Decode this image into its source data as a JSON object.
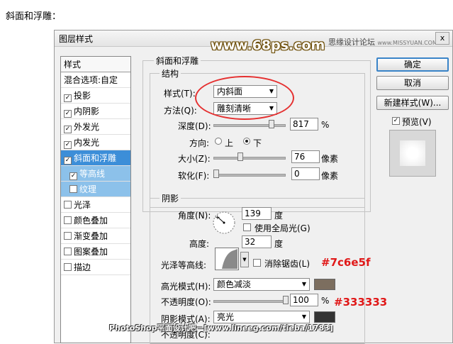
{
  "heading": "斜面和浮雕：",
  "dialog": {
    "title": "图层样式",
    "close": "x",
    "logo": "www.68ps.com",
    "watermark_cn": "思缘设计论坛",
    "watermark_en": "www.MISSYUAN.COM"
  },
  "style_list": {
    "header": "样式",
    "items": [
      {
        "label": "混合选项:自定",
        "checked": null
      },
      {
        "label": "投影",
        "checked": "✓"
      },
      {
        "label": "内阴影",
        "checked": "✓"
      },
      {
        "label": "外发光",
        "checked": "✓"
      },
      {
        "label": "内发光",
        "checked": "✓"
      },
      {
        "label": "斜面和浮雕",
        "checked": "✓"
      },
      {
        "label": "等高线",
        "checked": "✓"
      },
      {
        "label": "纹理",
        "checked": ""
      },
      {
        "label": "光泽",
        "checked": ""
      },
      {
        "label": "颜色叠加",
        "checked": ""
      },
      {
        "label": "渐变叠加",
        "checked": ""
      },
      {
        "label": "图案叠加",
        "checked": ""
      },
      {
        "label": "描边",
        "checked": ""
      }
    ]
  },
  "bevel": {
    "group": "斜面和浮雕",
    "structure": "结构",
    "style_label": "样式(T):",
    "style_value": "内斜面",
    "method_label": "方法(Q):",
    "method_value": "雕刻清晰",
    "depth_label": "深度(D):",
    "depth_value": "817",
    "depth_unit": "%",
    "direction_label": "方向:",
    "dir_up": "上",
    "dir_down": "下",
    "size_label": "大小(Z):",
    "size_value": "76",
    "size_unit": "像素",
    "soften_label": "软化(F):",
    "soften_value": "0",
    "soften_unit": "像素"
  },
  "shading": {
    "group": "阴影",
    "angle_label": "角度(N):",
    "angle_value": "139",
    "angle_unit": "度",
    "global_light": "使用全局光(G)",
    "altitude_label": "高度:",
    "altitude_value": "32",
    "altitude_unit": "度",
    "gloss_label": "光泽等高线:",
    "antialias": "消除锯齿(L)",
    "highlight_label": "高光模式(H):",
    "highlight_value": "颜色减淡",
    "highlight_color": "#7c6e5f",
    "opacity1_label": "不透明度(O):",
    "opacity1_value": "100",
    "opacity1_unit": "%",
    "shadow_label": "阴影模式(A):",
    "shadow_value": "亮光",
    "shadow_color": "#333333",
    "opacity2_label": "不透明度(C):"
  },
  "buttons": {
    "ok": "确定",
    "cancel": "取消",
    "new_style": "新建样式(W)...",
    "preview": "预览(V)"
  },
  "annotations": {
    "highlight_hex": "#7c6e5f",
    "shadow_hex": "#333333"
  },
  "bottom_watermark": "PhotoShop平面设计吧－[www.lineeg.com/tieba/1783]"
}
